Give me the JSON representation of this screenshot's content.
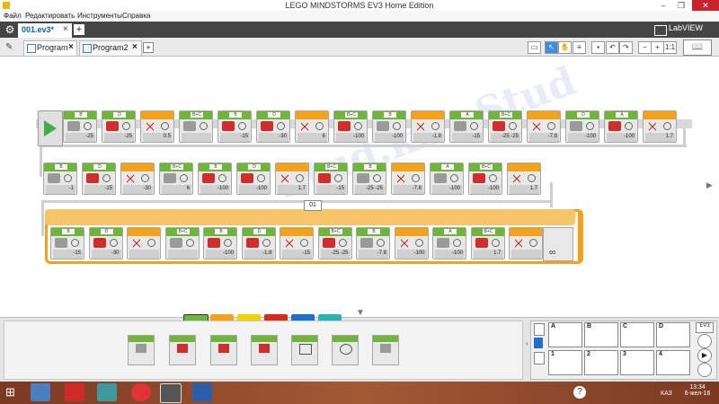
{
  "window": {
    "title": "LEGO MINDSTORMS EV3 Home Edition",
    "minimize": "–",
    "maximize": "❐",
    "close": "✕"
  },
  "menu": [
    "Файл",
    "Редактировать",
    "Инструменты",
    "Справка"
  ],
  "project": {
    "tab": "001.ev3*",
    "close": "×",
    "add": "+"
  },
  "brand": "LabVIEW",
  "programs": [
    {
      "name": "Program",
      "active": true
    },
    {
      "name": "Program2",
      "active": false
    }
  ],
  "program_add": "+",
  "toolbar": {
    "zoom_ratio": "1:1"
  },
  "loop_label": "01",
  "rows": [
    [
      "-25",
      "-25",
      "0.5",
      "",
      "-15",
      "-30",
      "6",
      "-100",
      "-100",
      "-1.8",
      "-15",
      "-25 -25",
      "-7.8",
      "-100",
      "-100",
      "1.7"
    ],
    [
      "-1",
      "-15",
      "-30",
      "6",
      "-100",
      "-100",
      "1.7",
      "-15",
      "-25 -25",
      "-7.8",
      "-100",
      "-100",
      "1.7"
    ],
    [
      "-15",
      "-30",
      "",
      "",
      "-100",
      "-1.8",
      "-15",
      "-25 -25",
      "-7.8",
      "-100",
      "-100",
      "1.7",
      ""
    ]
  ],
  "port_labels": [
    "B",
    "D",
    "A",
    "B+C"
  ],
  "palette_tabs": [
    "#6fb53c",
    "#f3a21a",
    "#f0d400",
    "#d9291c",
    "#1f6fd1",
    "#27b5b0"
  ],
  "hardware": {
    "motor_ports": [
      "A",
      "B",
      "C",
      "D"
    ],
    "sensor_ports": [
      "1",
      "2",
      "3",
      "4"
    ]
  },
  "taskbar": {
    "language": "КАЗ",
    "time": "13:34",
    "date": "6-жел-16"
  },
  "watermark": "Stud.kz - Stud"
}
